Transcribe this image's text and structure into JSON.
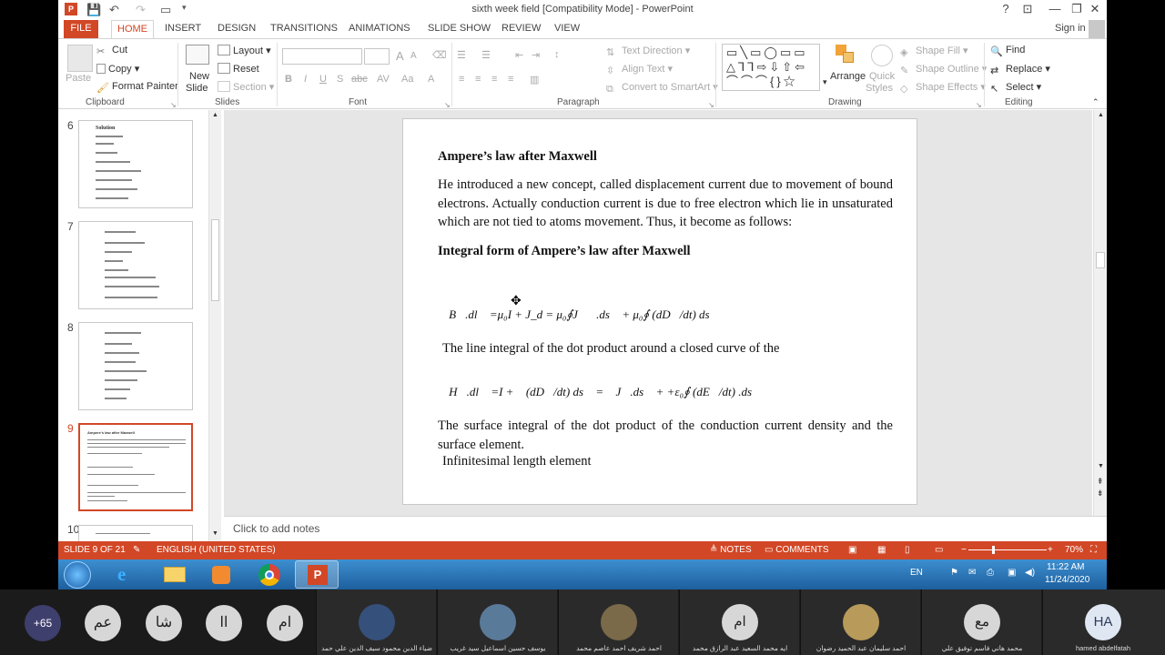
{
  "window": {
    "title": "sixth week field [Compatibility Mode] - PowerPoint",
    "controls": [
      "?",
      "⊡",
      "—",
      "❐",
      "✕"
    ],
    "sign_in": "Sign in"
  },
  "tabs": [
    "FILE",
    "HOME",
    "INSERT",
    "DESIGN",
    "TRANSITIONS",
    "ANIMATIONS",
    "SLIDE SHOW",
    "REVIEW",
    "VIEW"
  ],
  "active_tab": "HOME",
  "ribbon": {
    "clipboard": {
      "paste": "Paste",
      "cut": "Cut",
      "copy": "Copy",
      "format_painter": "Format Painter",
      "label": "Clipboard"
    },
    "slides": {
      "new_slide_1": "New",
      "new_slide_2": "Slide",
      "layout": "Layout",
      "reset": "Reset",
      "section": "Section",
      "label": "Slides"
    },
    "font": {
      "label": "Font",
      "bold": "B",
      "italic": "I",
      "underline": "U",
      "shadow": "S",
      "strike": "abc"
    },
    "paragraph": {
      "text_direction": "Text Direction",
      "align_text": "Align Text",
      "convert_smartart": "Convert to SmartArt",
      "label": "Paragraph"
    },
    "drawing": {
      "arrange": "Arrange",
      "quick_styles_1": "Quick",
      "quick_styles_2": "Styles",
      "shape_fill": "Shape Fill",
      "shape_outline": "Shape Outline",
      "shape_effects": "Shape Effects",
      "label": "Drawing"
    },
    "editing": {
      "find": "Find",
      "replace": "Replace",
      "select": "Select",
      "label": "Editing"
    }
  },
  "thumbnails": [
    {
      "num": "6",
      "heading": "Solution"
    },
    {
      "num": "7",
      "heading": ""
    },
    {
      "num": "8",
      "heading": ""
    },
    {
      "num": "9",
      "heading": "Ampere's law after Maxwell",
      "selected": true
    },
    {
      "num": "10",
      "heading": ""
    }
  ],
  "slide": {
    "heading1": "Ampere’s law after Maxwell",
    "para1": "He introduced a new concept, called displacement current due to movement of bound electrons. Actually conduction current is due to free electron which lie in unsaturated which are not tied to atoms movement. Thus, it become as follows:",
    "heading2": "Integral form of Ampere’s law after Maxwell",
    "eq1": "∮B⃗.dl⃗ =μ₀I + J_d = μ₀∮J⃗꜀.ds⃗ + μ₀∮ (dD⃗/dt) ds⃗",
    "line1": "The line integral of the dot product around a closed curve  of the",
    "eq2": "∮H⃗.dl⃗ =I +∮ (dD⃗/dt) ds⃗ = ∮J⃗.ds⃗ + +ε₀∮ (dE⃗/dt) .ds⃗",
    "para2": "The surface integral of the dot product of the conduction current density and the surface element.",
    "line2": "Infinitesimal length element"
  },
  "notes_placeholder": "Click to add notes",
  "status": {
    "slide": "SLIDE 9 OF 21",
    "language": "ENGLISH (UNITED STATES)",
    "notes": "NOTES",
    "comments": "COMMENTS",
    "zoom": "70%"
  },
  "taskbar": {
    "lang": "EN",
    "time": "11:22 AM",
    "date": "11/24/2020"
  },
  "participants": {
    "overflow": "+65",
    "avatars": [
      "عم",
      "شا",
      "اا",
      "ام"
    ],
    "tiles": [
      {
        "initials": "",
        "name": "ضياء الدين محمود سيف الدين علي حمد"
      },
      {
        "initials": "",
        "name": "يوسف حسين اسماعيل سيد غريب"
      },
      {
        "initials": "",
        "name": "احمد شريف احمد عاصم محمد"
      },
      {
        "initials": "ام",
        "name": "ايه محمد السعيد عبد الرازق محمد"
      },
      {
        "initials": "",
        "name": "احمد سليمان عبد الحميد رضوان"
      },
      {
        "initials": "مع",
        "name": "محمد هاني قاسم توفيق علي"
      },
      {
        "initials": "HA",
        "name": "hamed abdelfatah"
      }
    ]
  }
}
